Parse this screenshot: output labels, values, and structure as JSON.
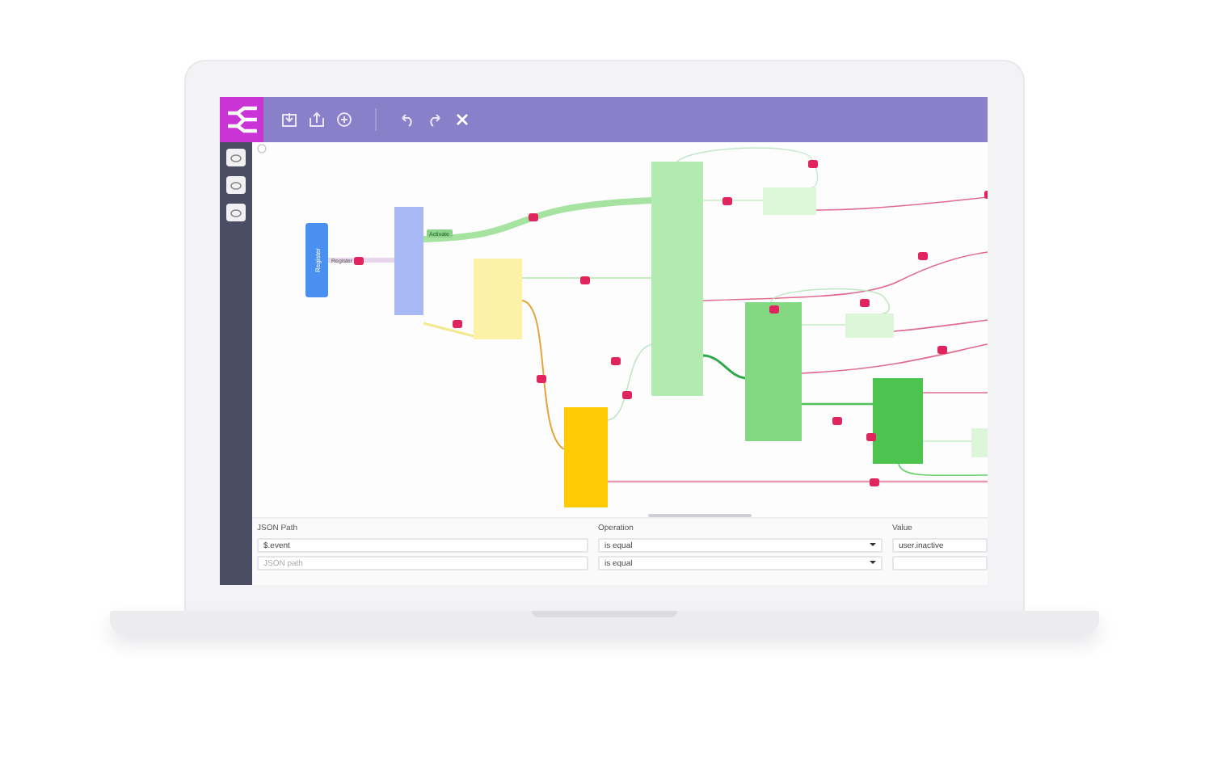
{
  "diagram": {
    "nodes": [
      {
        "label": "Register"
      }
    ],
    "links": [
      {
        "label": "Register"
      },
      {
        "label": "Activate"
      }
    ]
  },
  "filters": {
    "columns": [
      "JSON Path",
      "Operation",
      "Value"
    ],
    "rows": [
      {
        "path": "$.event",
        "operation": "is equal",
        "value": "user.inactive"
      },
      {
        "placeholder": "JSON path",
        "operation": "is equal"
      }
    ]
  }
}
